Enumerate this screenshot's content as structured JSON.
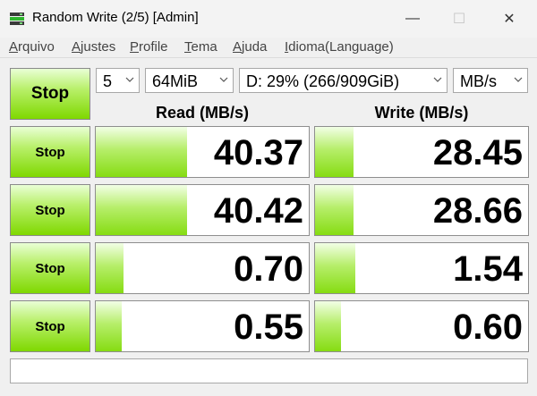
{
  "window": {
    "title": "Random Write (2/5) [Admin]",
    "minimize_glyph": "—",
    "maximize_glyph": "☐",
    "close_glyph": "✕"
  },
  "menu": {
    "items": [
      {
        "first": "A",
        "rest": "rquivo"
      },
      {
        "first": "A",
        "rest": "justes"
      },
      {
        "first": "P",
        "rest": "rofile"
      },
      {
        "first": "T",
        "rest": "ema"
      },
      {
        "first": "A",
        "rest": "juda"
      },
      {
        "first": "I",
        "rest": "dioma(Language)"
      }
    ]
  },
  "controls": {
    "main_button": "Stop",
    "count": "5",
    "size": "64MiB",
    "drive": "D: 29% (266/909GiB)",
    "unit": "MB/s"
  },
  "columns": {
    "read": "Read (MB/s)",
    "write": "Write (MB/s)"
  },
  "rows": [
    {
      "button": "Stop",
      "read": "40.37",
      "write": "28.45",
      "read_level": 0.43,
      "write_level": 0.18
    },
    {
      "button": "Stop",
      "read": "40.42",
      "write": "28.66",
      "read_level": 0.43,
      "write_level": 0.18
    },
    {
      "button": "Stop",
      "read": "0.70",
      "write": "1.54",
      "read_level": 0.13,
      "write_level": 0.19
    },
    {
      "button": "Stop",
      "read": "0.55",
      "write": "0.60",
      "read_level": 0.12,
      "write_level": 0.12
    }
  ],
  "status": {
    "text": ""
  },
  "colors": {
    "button_green": "#7fd800",
    "bar_green": "#86dc12"
  }
}
